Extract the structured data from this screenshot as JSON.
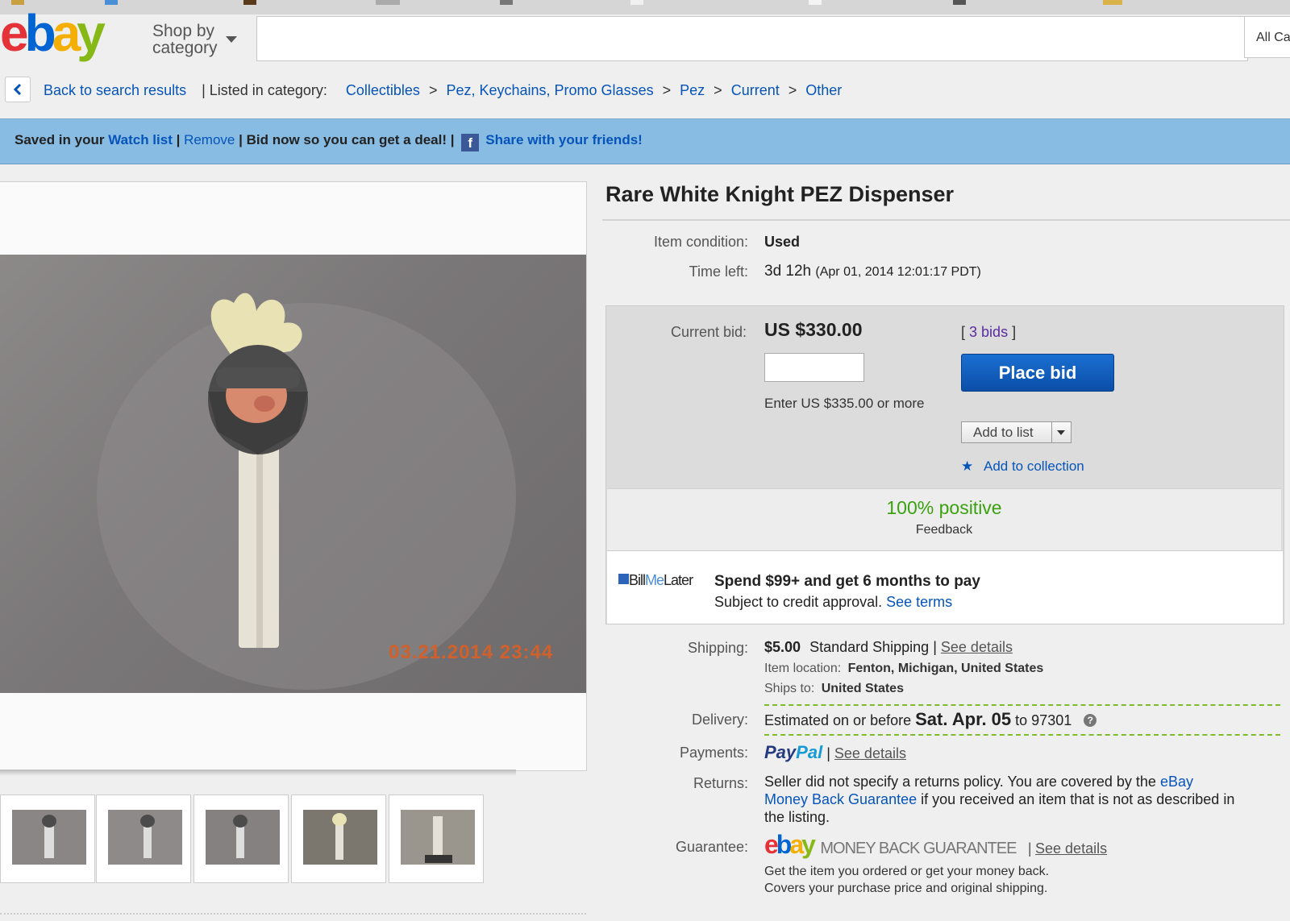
{
  "header": {
    "logo": {
      "e": "e",
      "b": "b",
      "a": "a",
      "y": "y"
    },
    "shop_by_line1": "Shop by",
    "shop_by_line2": "category",
    "search_placeholder": "",
    "all_categories": "All Ca"
  },
  "breadcrumb": {
    "back": "Back to search results",
    "listed_in": "| Listed in category:",
    "items": [
      "Collectibles",
      "Pez, Keychains, Promo Glasses",
      "Pez",
      "Current",
      "Other"
    ],
    "separator": ">"
  },
  "watchbar": {
    "saved_prefix": "Saved in your",
    "watch_list": "Watch list",
    "remove": "Remove",
    "bid_now": "Bid now so you can get a deal!",
    "fb": "f",
    "share": "Share with your friends!"
  },
  "photo": {
    "timestamp": "03.21.2014 23:44"
  },
  "thumbnails_count": 5,
  "item": {
    "title": "Rare White Knight PEZ Dispenser",
    "condition_label": "Item condition:",
    "condition": "Used",
    "time_left_label": "Time left:",
    "time_left": "3d 12h",
    "time_left_detail": "(Apr 01, 2014  12:01:17 PDT)"
  },
  "bid": {
    "current_bid_label": "Current bid:",
    "current_bid": "US $330.00",
    "bids_open": "[",
    "bids_link": "3 bids",
    "bids_close": "]",
    "input_value": "",
    "enter_hint": "Enter US $335.00 or more",
    "place_bid": "Place bid",
    "add_to_list": "Add to list",
    "add_to_collection": "Add to collection"
  },
  "feedback": {
    "percent": "100% positive",
    "label": "Feedback"
  },
  "billmelater": {
    "logo_bill": "Bill",
    "logo_me": "Me",
    "logo_later": "Later",
    "headline": "Spend $99+ and get 6 months to pay",
    "sub": "Subject to credit approval.",
    "see_terms": "See terms"
  },
  "shipping": {
    "label": "Shipping:",
    "price": "$5.00",
    "method": "Standard Shipping",
    "pipe": "|",
    "see_details": "See details",
    "location_label": "Item location:",
    "location": "Fenton, Michigan, United States",
    "ships_to_label": "Ships to:",
    "ships_to": "United States"
  },
  "delivery": {
    "label": "Delivery:",
    "prefix": "Estimated on or before",
    "date": "Sat. Apr. 05",
    "suffix": "to 97301",
    "help": "?"
  },
  "payments": {
    "label": "Payments:",
    "paypal_pay": "Pay",
    "paypal_pal": "Pal",
    "pipe": "|",
    "see_details": "See details"
  },
  "returns": {
    "label": "Returns:",
    "text1": "Seller did not specify a returns policy. You are covered by the",
    "link_part1": "eBay",
    "link_part2": "Money Back Guarantee",
    "text2": "if you received an item that is not as described in",
    "text3": "the listing."
  },
  "guarantee": {
    "label": "Guarantee:",
    "mbg": "MONEY BACK GUARANTEE",
    "pipe": "|",
    "see_details": "See details",
    "line1": "Get the item you ordered or get your money back.",
    "line2": "Covers your purchase price and original shipping."
  },
  "colors": {
    "accent_blue": "#0654ba",
    "watchbar": "#88bce3",
    "place_bid": "#0b4ea8",
    "positive_green": "#3aa10f"
  }
}
